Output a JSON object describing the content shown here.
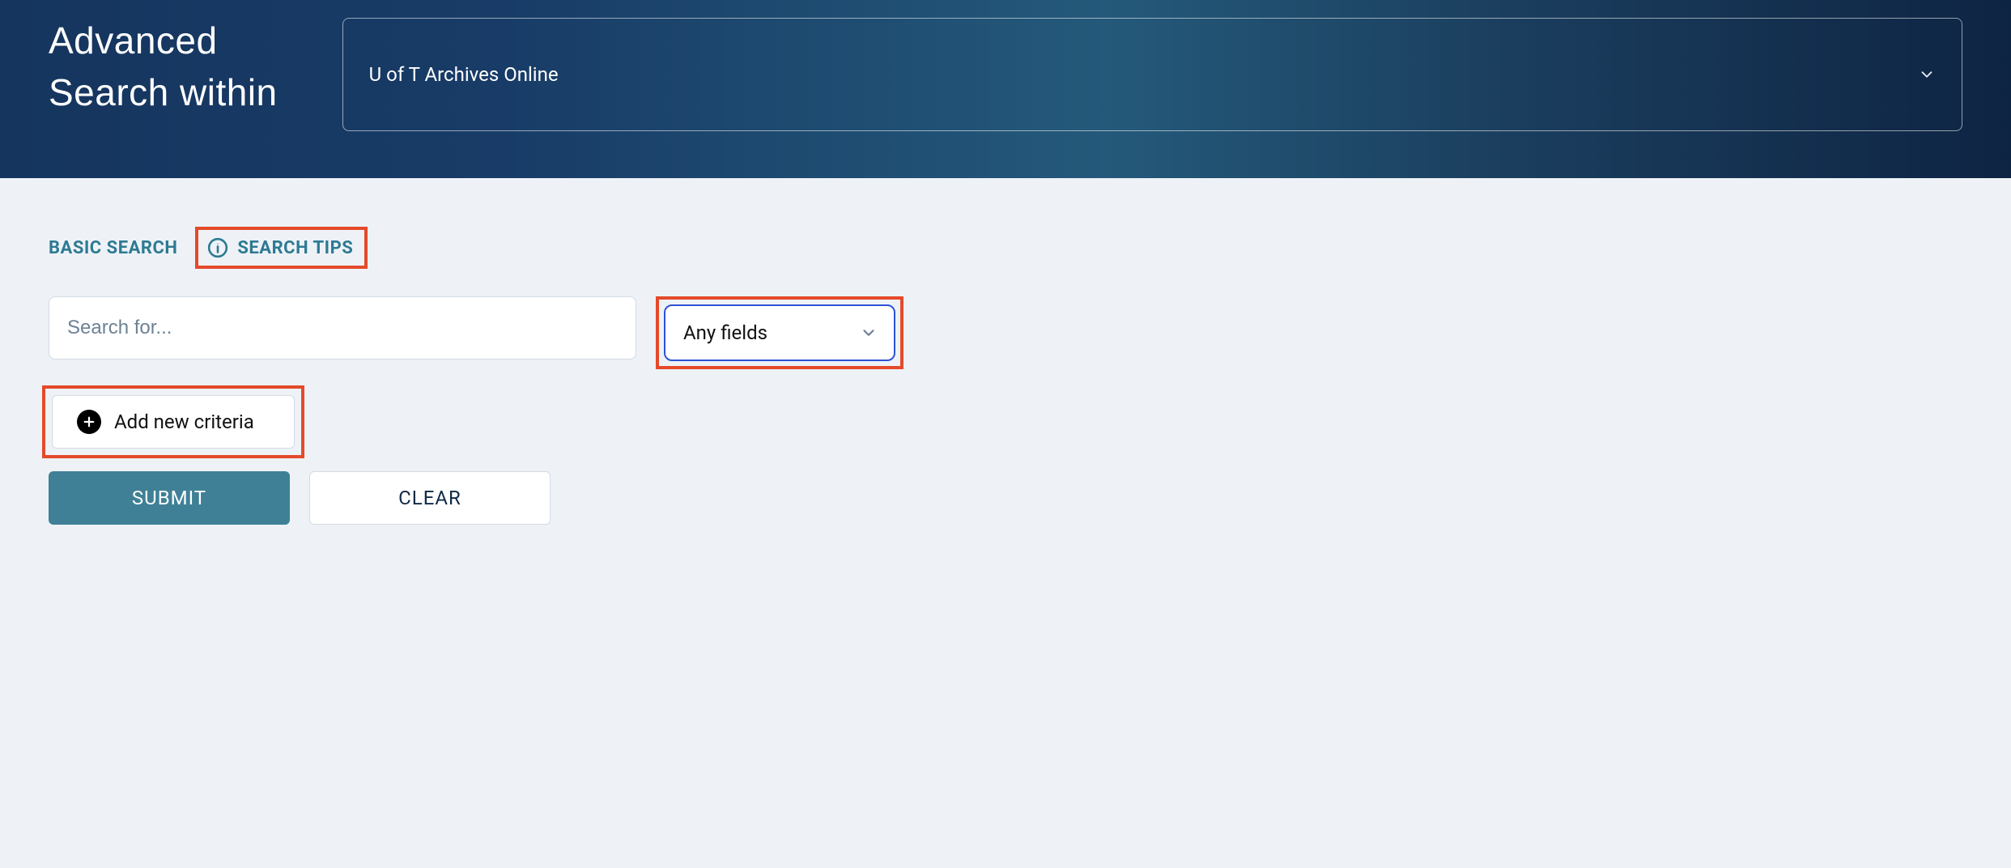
{
  "banner": {
    "title_line1": "Advanced",
    "title_line2": "Search within",
    "scope_value": "U of T Archives Online"
  },
  "tabs": {
    "basic_search": "BASIC SEARCH",
    "search_tips": "SEARCH TIPS"
  },
  "search": {
    "placeholder": "Search for...",
    "value": "",
    "field_selected": "Any fields"
  },
  "buttons": {
    "add_criteria": "Add new criteria",
    "submit": "SUBMIT",
    "clear": "CLEAR"
  },
  "colors": {
    "highlight_border": "#e44a2a",
    "select_focus": "#2d52d6",
    "teal_link": "#2d7a93",
    "primary_btn": "#3f8096"
  }
}
